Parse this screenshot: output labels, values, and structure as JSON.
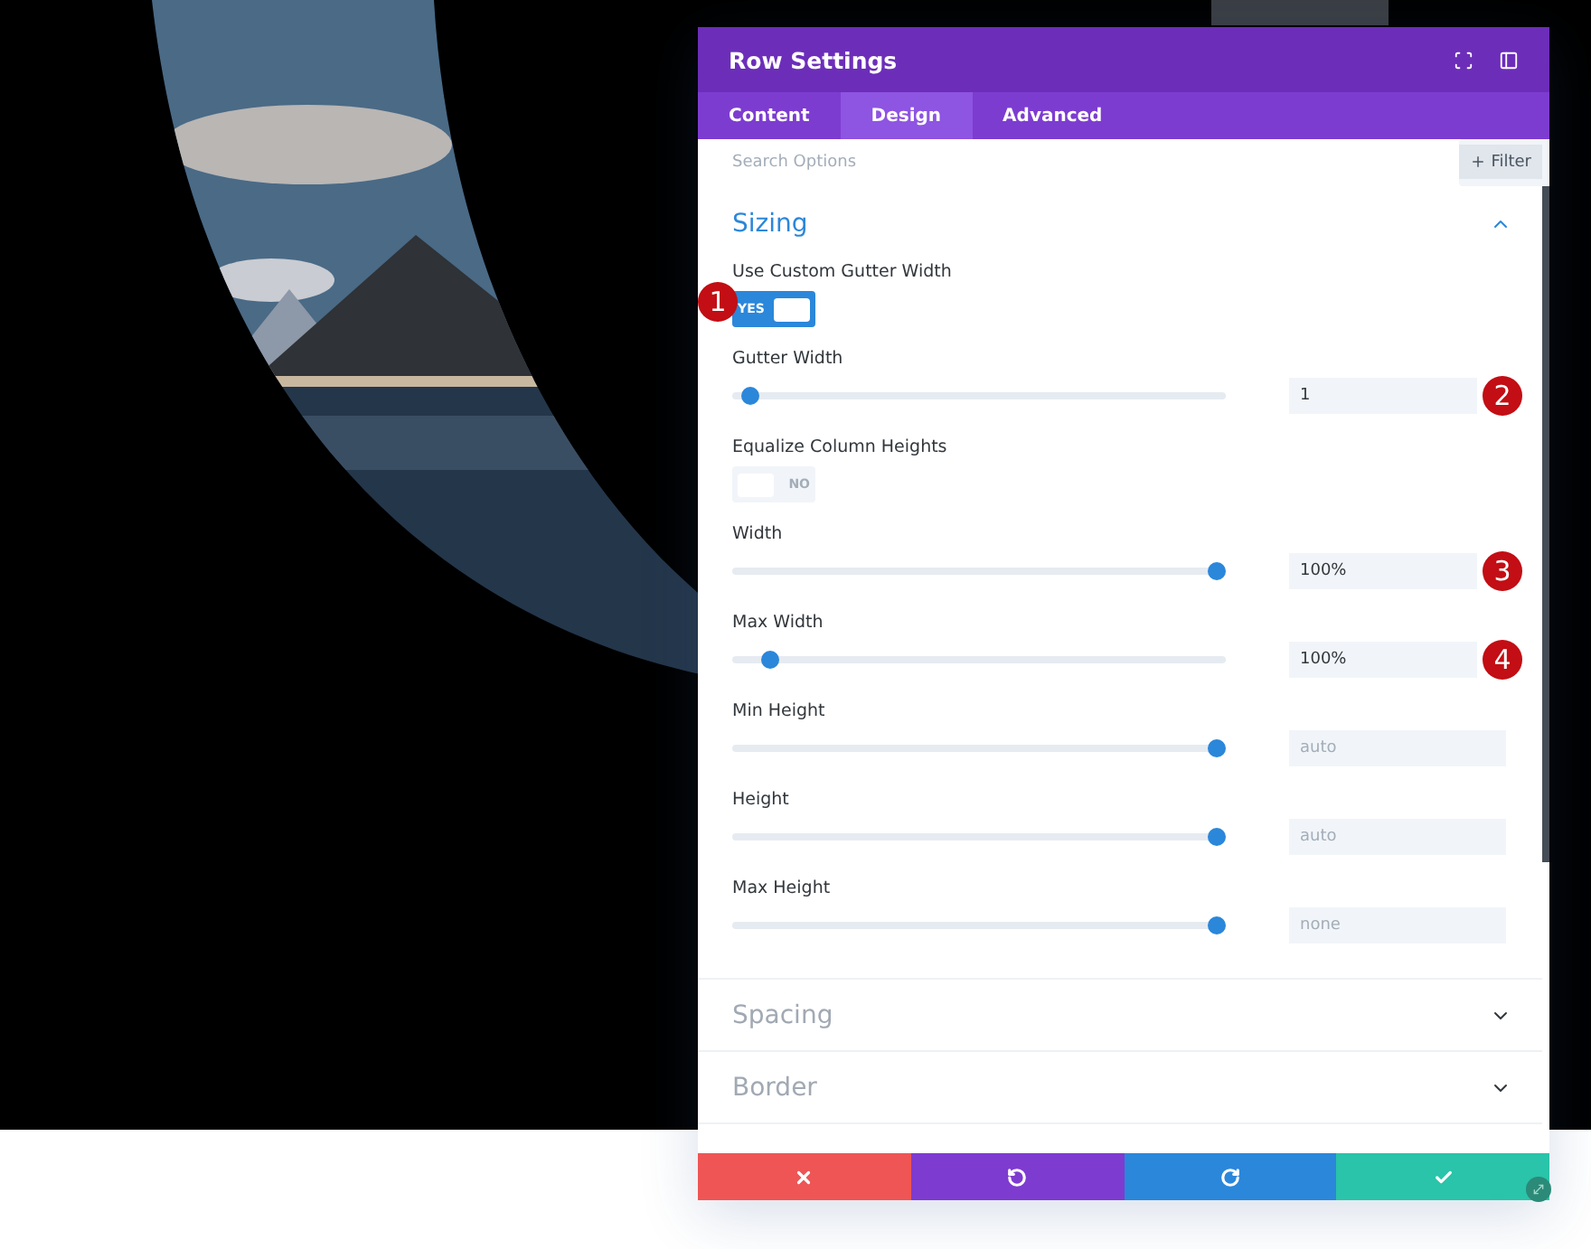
{
  "modal": {
    "title": "Row Settings",
    "tabs": [
      {
        "label": "Content",
        "selected": false
      },
      {
        "label": "Design",
        "selected": true
      },
      {
        "label": "Advanced",
        "selected": false
      }
    ],
    "search": {
      "placeholder": "Search Options",
      "filter_label": "Filter"
    },
    "sections": [
      {
        "title": "Sizing",
        "expanded": true,
        "options": [
          {
            "kind": "toggle",
            "label": "Use Custom Gutter Width",
            "on": true,
            "state_text": "YES",
            "marker": "1"
          },
          {
            "kind": "slider",
            "label": "Gutter Width",
            "level": 0.02,
            "value": "1",
            "marker": "2"
          },
          {
            "kind": "toggle",
            "label": "Equalize Column Heights",
            "on": false,
            "state_text": "NO"
          },
          {
            "kind": "slider",
            "label": "Width",
            "level": 1,
            "value": "100%",
            "marker": "3"
          },
          {
            "kind": "slider",
            "label": "Max Width",
            "level": 0.06,
            "value": "100%",
            "marker": "4"
          },
          {
            "kind": "slider",
            "label": "Min Height",
            "level": 1,
            "placeholder": "auto"
          },
          {
            "kind": "slider",
            "label": "Height",
            "level": 1,
            "placeholder": "auto"
          },
          {
            "kind": "slider",
            "label": "Max Height",
            "level": 1,
            "placeholder": "none"
          }
        ]
      },
      {
        "title": "Spacing",
        "expanded": false
      },
      {
        "title": "Border",
        "expanded": false
      }
    ],
    "footer_buttons": [
      {
        "kind": "cancel"
      },
      {
        "kind": "undo"
      },
      {
        "kind": "redo"
      },
      {
        "kind": "save"
      }
    ]
  }
}
